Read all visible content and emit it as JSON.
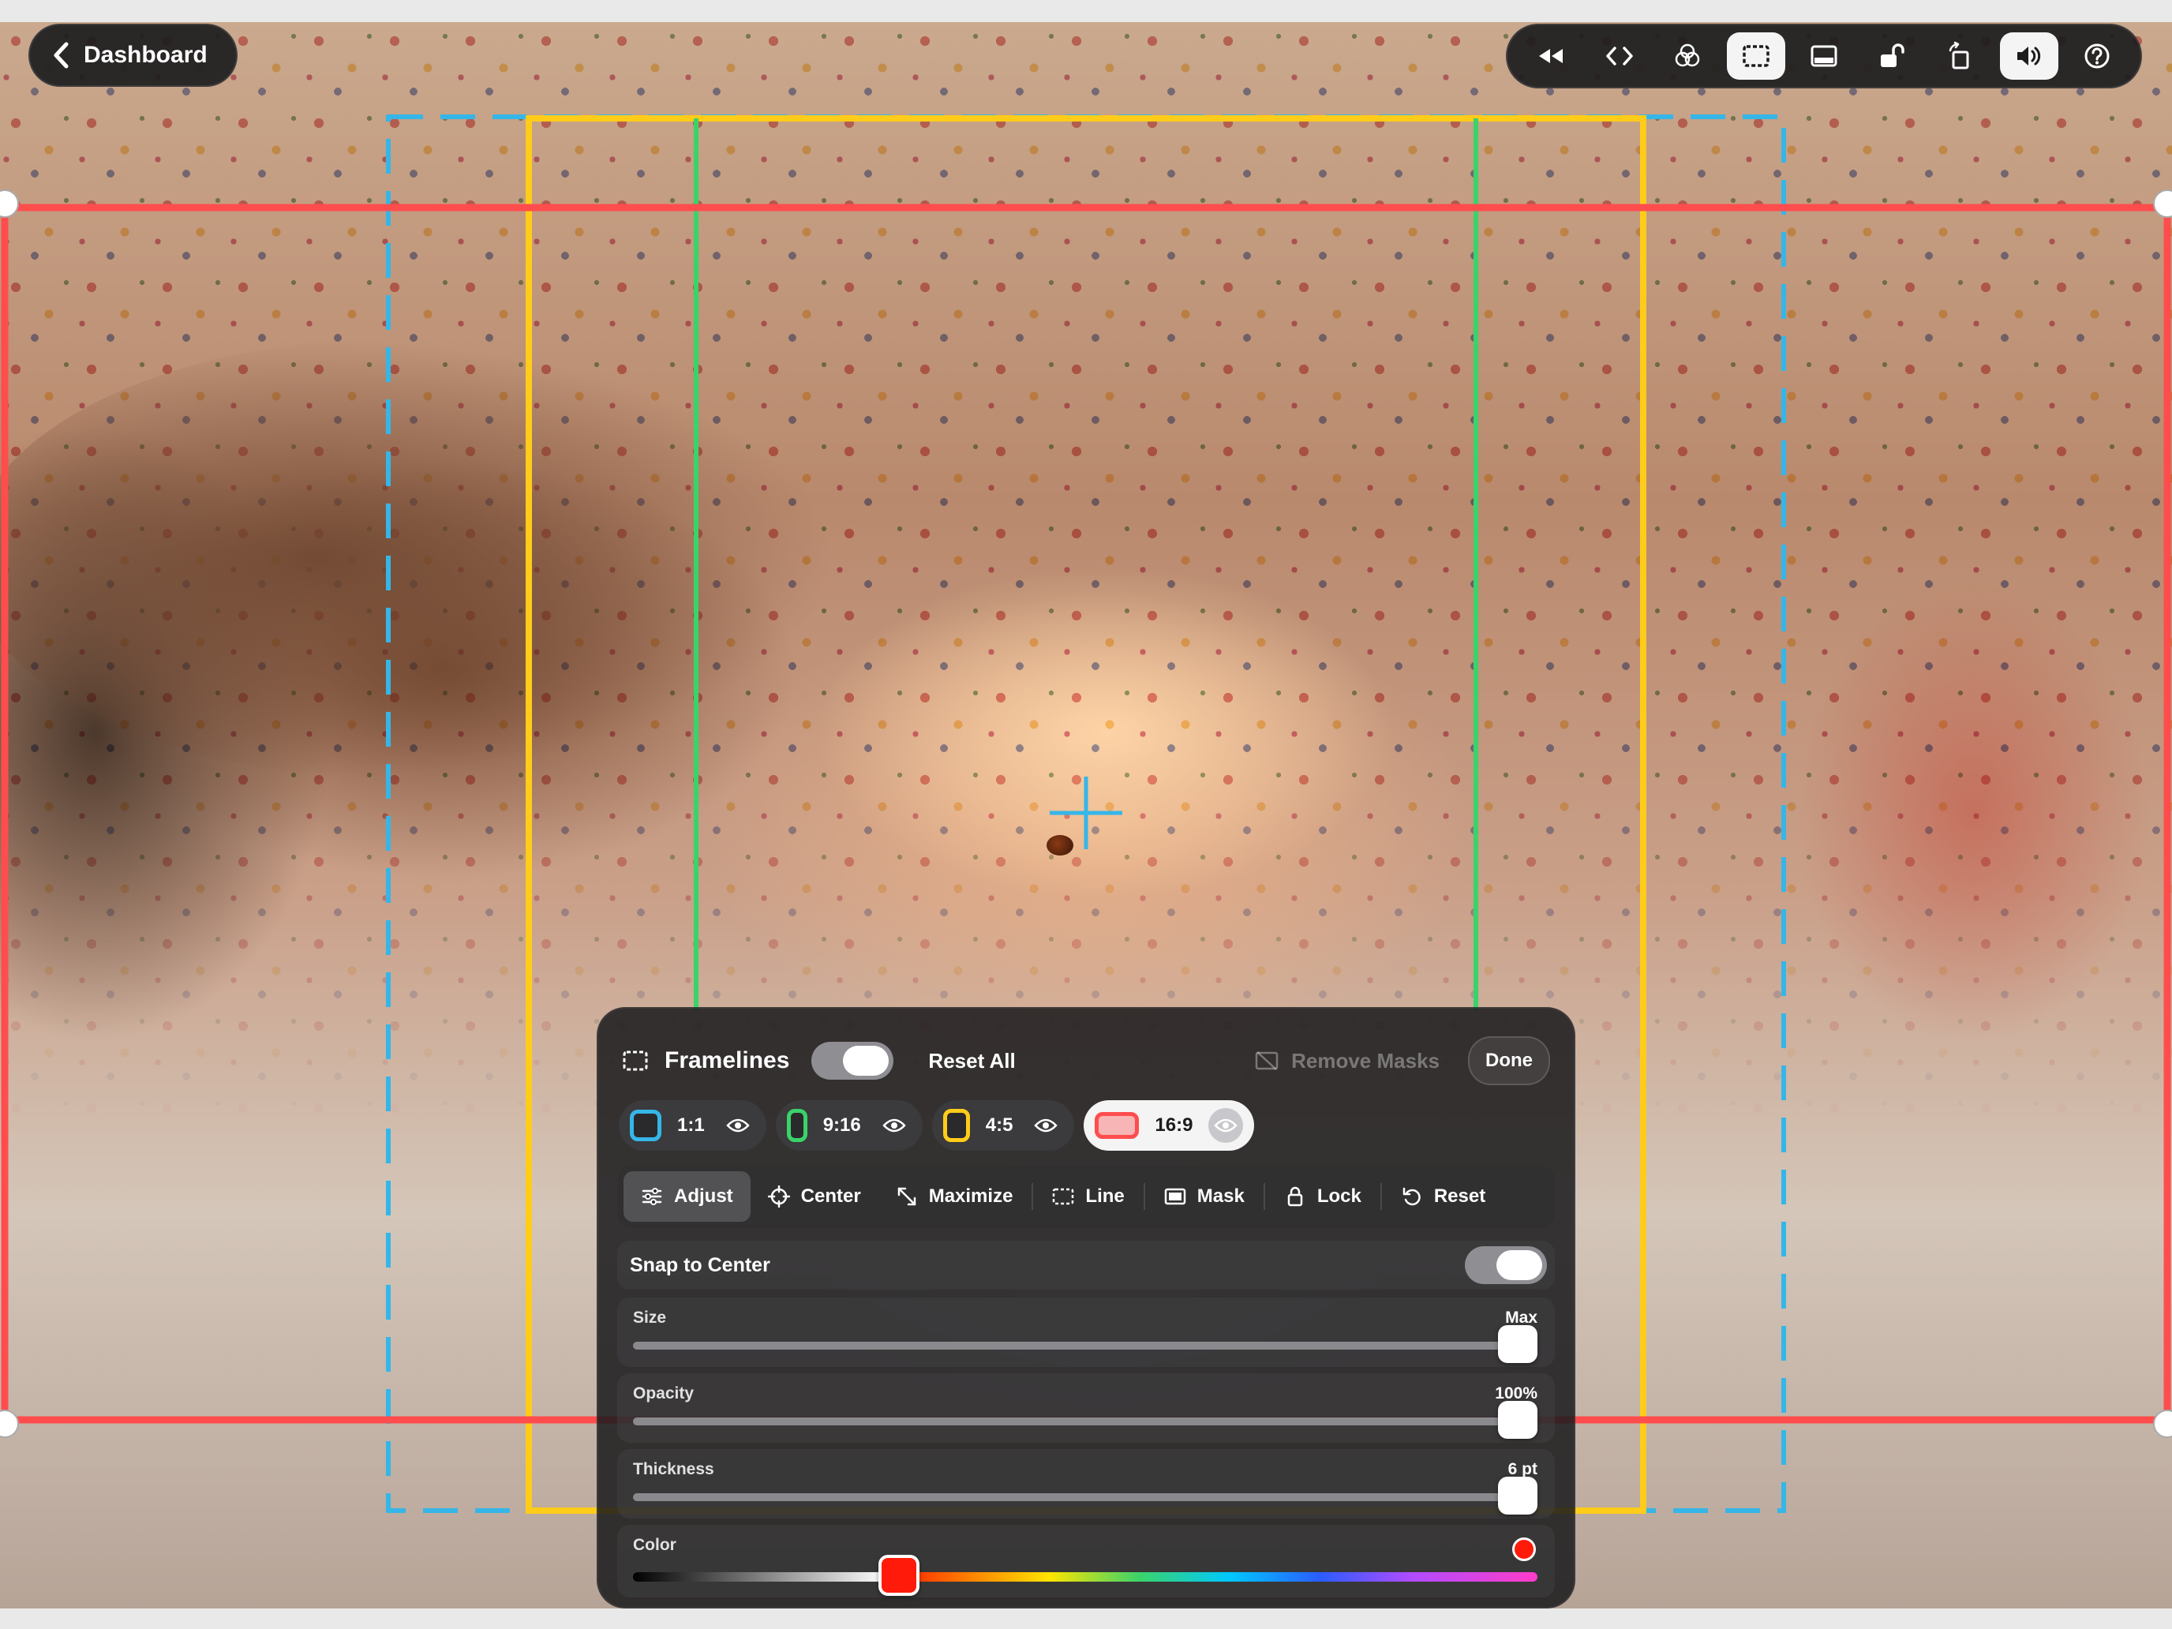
{
  "window": {
    "back_label": "Dashboard"
  },
  "toolbar": {
    "buttons": [
      {
        "icon": "rewind-icon",
        "active": false
      },
      {
        "icon": "code-icon",
        "active": false
      },
      {
        "icon": "color-filter-icon",
        "active": false
      },
      {
        "icon": "framelines-icon",
        "active": true
      },
      {
        "icon": "safe-area-icon",
        "active": false
      },
      {
        "icon": "unlock-icon",
        "active": false
      },
      {
        "icon": "rotate-icon",
        "active": false
      },
      {
        "icon": "speaker-icon",
        "active": true
      },
      {
        "icon": "help-icon",
        "active": false
      }
    ]
  },
  "panel": {
    "title": "Framelines",
    "enabled": true,
    "reset_all_label": "Reset All",
    "remove_masks_label": "Remove Masks",
    "done_label": "Done",
    "presets": [
      {
        "label": "1:1",
        "color": "#35b6e8",
        "selected": false,
        "visible": true
      },
      {
        "label": "9:16",
        "color": "#3ad36a",
        "selected": false,
        "visible": true
      },
      {
        "label": "4:5",
        "color": "#ffcc1a",
        "selected": false,
        "visible": true
      },
      {
        "label": "16:9",
        "color": "#ff4d4d",
        "selected": true,
        "visible": true
      }
    ],
    "tabs": [
      {
        "label": "Adjust",
        "icon": "sliders-icon",
        "active": true
      },
      {
        "label": "Center",
        "icon": "crosshair-icon",
        "active": false
      },
      {
        "label": "Maximize",
        "icon": "expand-icon",
        "active": false
      },
      {
        "label": "Line",
        "icon": "dashed-rect-icon",
        "active": false
      },
      {
        "label": "Mask",
        "icon": "mask-icon",
        "active": false
      },
      {
        "label": "Lock",
        "icon": "lock-icon",
        "active": false
      },
      {
        "label": "Reset",
        "icon": "reset-icon",
        "active": false
      }
    ],
    "snap": {
      "label": "Snap to Center",
      "on": true
    },
    "size": {
      "label": "Size",
      "value_text": "Max",
      "fraction": 1.0
    },
    "opacity": {
      "label": "Opacity",
      "value_text": "100%",
      "fraction": 1.0
    },
    "thickness": {
      "label": "Thickness",
      "value_text": "6 pt",
      "fraction": 1.0
    },
    "color": {
      "label": "Color",
      "value": "#ff1a0a",
      "fraction": 0.294
    }
  },
  "colors": {
    "frame_16x9": "#ff4d4d",
    "frame_1x1": "#35b6e8",
    "frame_9x16": "#3ad36a",
    "frame_4x5": "#ffcc1a"
  }
}
